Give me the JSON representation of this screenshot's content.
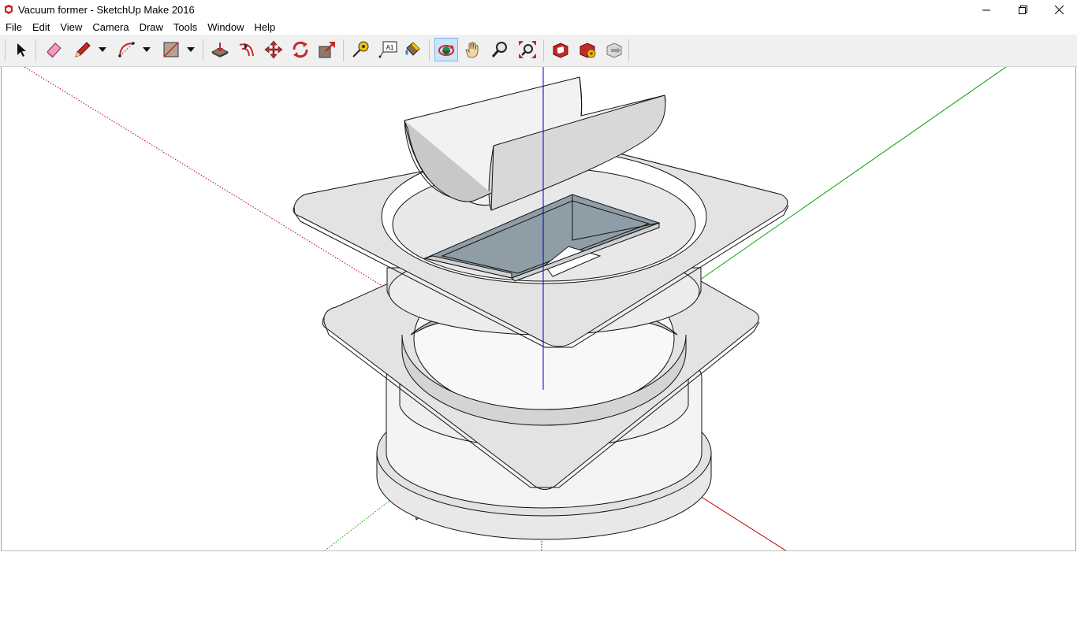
{
  "window": {
    "title": "Vacuum former - SketchUp Make 2016",
    "app_icon": "sketchup-icon",
    "controls": [
      "minimize-icon",
      "maximize-icon",
      "close-icon"
    ]
  },
  "menu": {
    "items": [
      "File",
      "Edit",
      "View",
      "Camera",
      "Draw",
      "Tools",
      "Window",
      "Help"
    ]
  },
  "toolbar": {
    "tools": [
      {
        "name": "select",
        "icon": "select-arrow-icon"
      },
      {
        "name": "eraser",
        "icon": "eraser-icon"
      },
      {
        "name": "line",
        "icon": "pencil-icon",
        "dropdown": true
      },
      {
        "name": "arc",
        "icon": "arc-icon",
        "dropdown": true
      },
      {
        "name": "rectangle",
        "icon": "rectangle-icon",
        "dropdown": true
      },
      {
        "name": "push-pull",
        "icon": "push-pull-icon"
      },
      {
        "name": "offset",
        "icon": "offset-icon"
      },
      {
        "name": "move",
        "icon": "move-icon"
      },
      {
        "name": "rotate",
        "icon": "rotate-icon"
      },
      {
        "name": "scale",
        "icon": "scale-icon"
      },
      {
        "name": "tape-measure",
        "icon": "tape-measure-icon"
      },
      {
        "name": "text",
        "icon": "text-icon"
      },
      {
        "name": "paint-bucket",
        "icon": "paint-bucket-icon"
      },
      {
        "name": "orbit",
        "icon": "orbit-icon",
        "active": true
      },
      {
        "name": "pan",
        "icon": "pan-hand-icon"
      },
      {
        "name": "zoom",
        "icon": "zoom-icon"
      },
      {
        "name": "zoom-extents",
        "icon": "zoom-extents-icon"
      },
      {
        "name": "3d-warehouse",
        "icon": "warehouse-icon"
      },
      {
        "name": "extension-warehouse",
        "icon": "extension-warehouse-icon"
      },
      {
        "name": "share-model",
        "icon": "share-model-icon"
      }
    ],
    "text_tool_label": "A1"
  },
  "colors": {
    "axis_red": "#c00000",
    "axis_green": "#00a000",
    "axis_blue": "#0000c0",
    "model_face": "#e2e2e2",
    "model_back_face": "#8f9ea6",
    "active_tool_bg": "#cce4f7"
  }
}
